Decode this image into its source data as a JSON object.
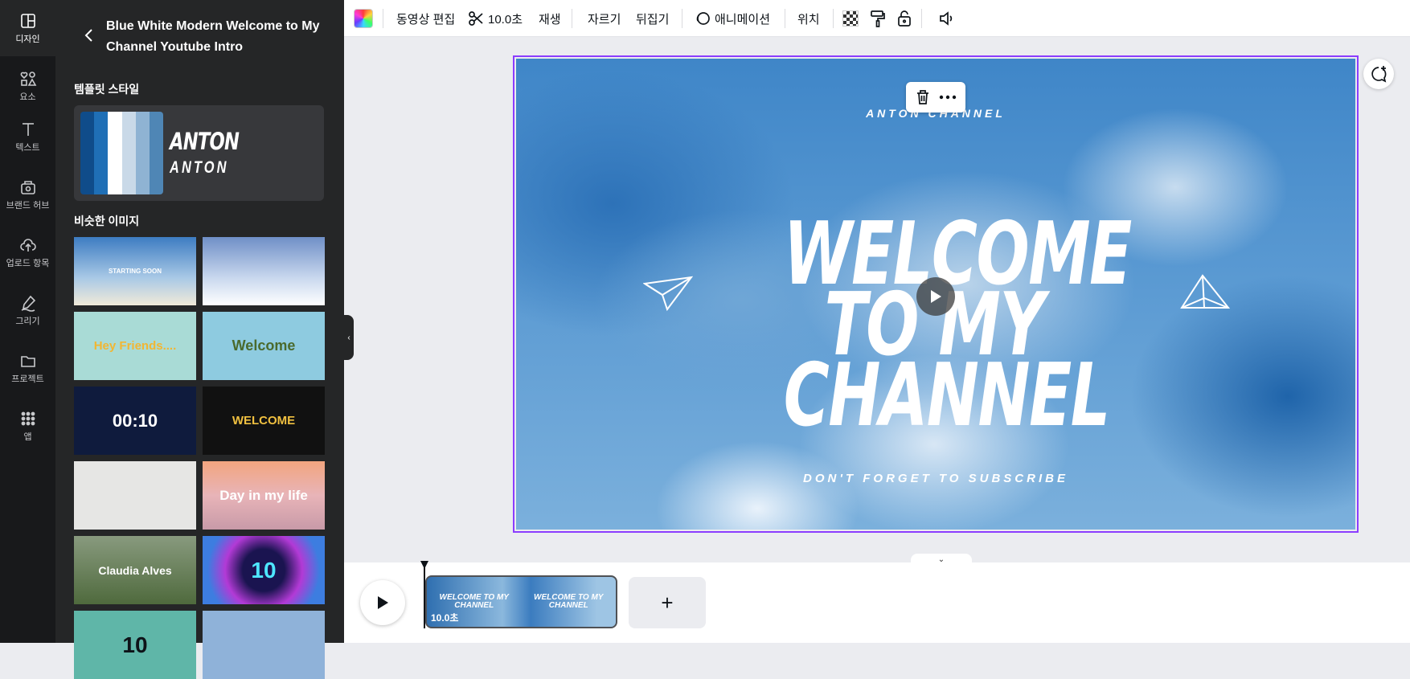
{
  "rail": [
    {
      "label": "디자인",
      "icon": "layout-icon",
      "active": true
    },
    {
      "label": "요소",
      "icon": "shapes-icon"
    },
    {
      "label": "텍스트",
      "icon": "text-icon"
    },
    {
      "label": "브랜드 허브",
      "icon": "brand-icon"
    },
    {
      "label": "업로드 항목",
      "icon": "upload-cloud-icon"
    },
    {
      "label": "그리기",
      "icon": "draw-icon"
    },
    {
      "label": "프로젝트",
      "icon": "folder-icon"
    },
    {
      "label": "앱",
      "icon": "apps-grid-icon"
    }
  ],
  "panel": {
    "title": "Blue White Modern Welcome to My Channel Youtube Intro",
    "style_section": "템플릿 스타일",
    "palette": [
      "#0f4c8a",
      "#1f6fb6",
      "#ffffff",
      "#c9d9e8",
      "#8fb3d3",
      "#4f86b5"
    ],
    "font_preview_1": "ANTON",
    "font_preview_2": "ANTON",
    "similar_section": "비슷한 이미지",
    "thumbs": [
      {
        "text": "STARTING SOON",
        "bg": "linear-gradient(180deg,#3d7cc2,#a9c9e6 60%,#f1ead9)",
        "color": "#fff",
        "size": "8px"
      },
      {
        "text": "",
        "bg": "linear-gradient(180deg,#6f8fc7,#c9d8ee 60%,#ffffff)",
        "color": "#fff",
        "size": "8px"
      },
      {
        "text": "Hey Friends....",
        "bg": "#a9dbd6",
        "color": "#f2b632",
        "size": "15px"
      },
      {
        "text": "Welcome",
        "bg": "#8ecbe0",
        "color": "#4a6a2d",
        "size": "18px"
      },
      {
        "text": "00:10",
        "bg": "#0f1b3d",
        "color": "#ffffff",
        "size": "22px"
      },
      {
        "text": "WELCOME",
        "bg": "#111111",
        "color": "#f0c040",
        "size": "15px"
      },
      {
        "text": "",
        "bg": "#e6e6e4",
        "color": "#333",
        "size": "8px"
      },
      {
        "text": "Day in my life",
        "bg": "linear-gradient(180deg,#f2a57f,#e8b4b8 50%,#c89aa8)",
        "color": "#fff",
        "size": "17px"
      },
      {
        "text": "Claudia Alves",
        "bg": "linear-gradient(180deg,#889a7e,#4f6a3d)",
        "color": "#fff",
        "size": "14px"
      },
      {
        "text": "10",
        "bg": "radial-gradient(circle,#1a1450 30%,#b23ad6 55%,#3d7de0 80%)",
        "color": "#4ee6ff",
        "size": "28px"
      },
      {
        "text": "10",
        "bg": "#5fb6a8",
        "color": "#0e1318",
        "size": "28px"
      },
      {
        "text": "",
        "bg": "#8fb2d9",
        "color": "#fff",
        "size": "8px"
      }
    ]
  },
  "toolbar": {
    "edit_video": "동영상 편집",
    "duration": "10.0초",
    "play": "재생",
    "crop": "자르기",
    "flip": "뒤집기",
    "animate": "애니메이션",
    "position": "위치"
  },
  "canvas": {
    "top_text": "ANTON CHANNEL",
    "headline": "WELCOME TO MY CHANNEL",
    "bottom_text": "DON'T FORGET TO SUBSCRIBE"
  },
  "timeline": {
    "clip_duration": "10.0초",
    "clip_thumb_text": "WELCOME TO MY CHANNEL",
    "add_label": "+"
  }
}
